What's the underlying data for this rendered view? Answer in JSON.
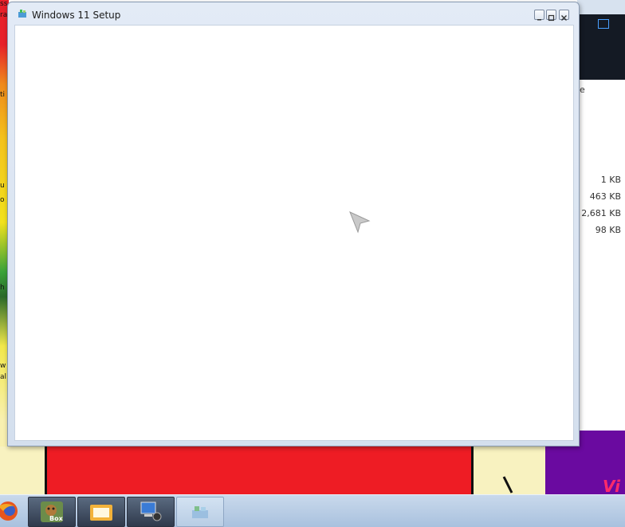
{
  "window": {
    "title": "Windows 11 Setup",
    "controls": [
      "minimize",
      "restore",
      "close"
    ]
  },
  "background_window": {
    "partial_text": "e",
    "file_sizes": [
      "1 KB",
      "463 KB",
      "2,681 KB",
      "98 KB"
    ]
  },
  "desktop": {
    "left_fragments": [
      "ss",
      "rat",
      "ti",
      "u",
      "o",
      "h",
      "w",
      "al"
    ],
    "wallpaper_text": "Vi"
  },
  "taskbar": {
    "items": [
      {
        "name": "firefox-icon"
      },
      {
        "name": "box-app",
        "label": "Box"
      },
      {
        "name": "folder-app"
      },
      {
        "name": "network-computer-app"
      },
      {
        "name": "windows-setup-app"
      }
    ]
  },
  "colors": {
    "window_frame": "#d4dfee",
    "taskbar": "#b8cde4",
    "wallpaper_red": "#ee1c24",
    "wallpaper_purple": "#6a0aa0"
  }
}
